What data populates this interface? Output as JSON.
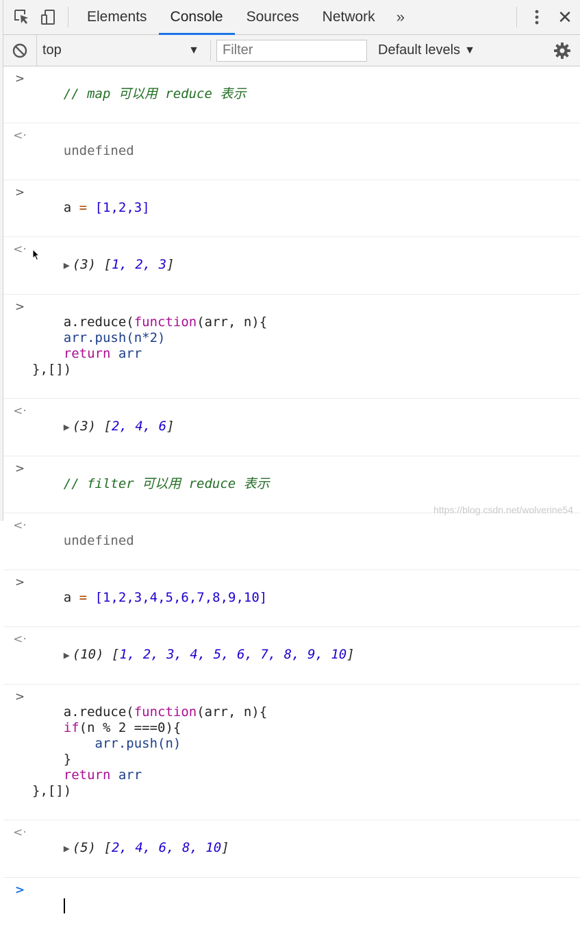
{
  "tabs": {
    "items": [
      "Elements",
      "Console",
      "Sources",
      "Network"
    ],
    "active": "Console",
    "more": "»",
    "close": "✕"
  },
  "toolbar": {
    "context": "top",
    "filter_placeholder": "Filter",
    "levels": "Default levels"
  },
  "console": {
    "comment_1": "// map 可以用 reduce 表示",
    "undefined_1": "undefined",
    "cmd_a1_var": "a",
    "cmd_a1_op": "=",
    "cmd_a1_val": "[1,2,3]",
    "res_1": {
      "len": "(3)",
      "open": "[",
      "vals": "1, 2, 3",
      "close": "]"
    },
    "map_code": {
      "l1_a": "a.reduce(",
      "l1_kw": "function",
      "l1_b": "(arr, n){",
      "l2": "    arr.push(n*2)",
      "l3_kw": "    return",
      "l3_b": " arr",
      "l4": "},[])"
    },
    "res_2": {
      "len": "(3)",
      "open": "[",
      "vals": "2, 4, 6",
      "close": "]"
    },
    "comment_2": "// filter 可以用 reduce 表示",
    "undefined_2": "undefined",
    "cmd_a2_var": "a",
    "cmd_a2_op": "=",
    "cmd_a2_val": "[1,2,3,4,5,6,7,8,9,10]",
    "res_3": {
      "len": "(10)",
      "open": "[",
      "vals": "1, 2, 3, 4, 5, 6, 7, 8, 9, 10",
      "close": "]"
    },
    "filter_code": {
      "l1_a": "a.reduce(",
      "l1_kw": "function",
      "l1_b": "(arr, n){",
      "l2_kw": "    if",
      "l2_b": "(n % 2 ===0){",
      "l3": "        arr.push(n)",
      "l4": "    }",
      "l5_kw": "    return",
      "l5_b": " arr",
      "l6": "},[])"
    },
    "res_4": {
      "len": "(5)",
      "open": "[",
      "vals": "2, 4, 6, 8, 10",
      "close": "]"
    }
  },
  "watermark": "https://blog.csdn.net/wolverine54",
  "colors": {
    "accent": "#1a73e8",
    "keyword": "#aa0d91",
    "number": "#1c00cf",
    "comment": "#236e25"
  }
}
